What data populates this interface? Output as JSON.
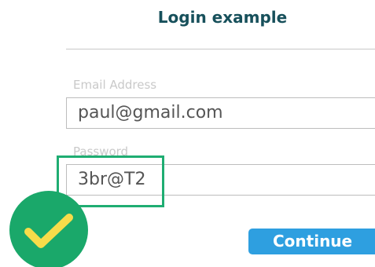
{
  "header": {
    "title": "Login example"
  },
  "form": {
    "email": {
      "label": "Email Address",
      "value": "paul@gmail.com"
    },
    "password": {
      "label": "Password",
      "value": "3br@T2"
    },
    "submit_label": "Continue"
  },
  "status": {
    "icon": "checkmark-icon"
  },
  "colors": {
    "title": "#17505b",
    "focus_outline": "#1fad72",
    "button": "#2e9fe0",
    "badge": "#1aa86a",
    "checkmark": "#f7dc4a"
  }
}
